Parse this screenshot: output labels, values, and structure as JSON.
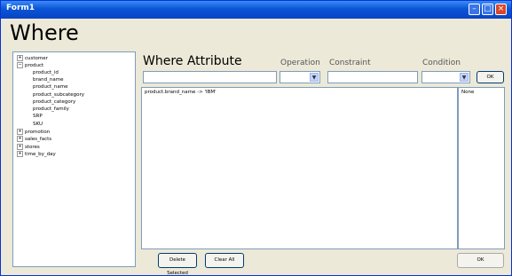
{
  "window": {
    "title": "Form1"
  },
  "heading": "Where",
  "tree": {
    "nodes": [
      {
        "label": "customer",
        "expander": "+"
      },
      {
        "label": "product",
        "expander": "−"
      },
      {
        "label": "product_id",
        "expander": ""
      },
      {
        "label": "brand_name",
        "expander": ""
      },
      {
        "label": "product_name",
        "expander": ""
      },
      {
        "label": "product_subcategory",
        "expander": ""
      },
      {
        "label": "product_category",
        "expander": ""
      },
      {
        "label": "product_family",
        "expander": ""
      },
      {
        "label": "SRP",
        "expander": ""
      },
      {
        "label": "SKU",
        "expander": ""
      },
      {
        "label": "promotion",
        "expander": "+"
      },
      {
        "label": "sales_facts",
        "expander": "+"
      },
      {
        "label": "stores",
        "expander": "+"
      },
      {
        "label": "time_by_day",
        "expander": "+"
      }
    ]
  },
  "where_attribute": {
    "title": "Where Attribute"
  },
  "labels": {
    "operation": "Operation",
    "constraint": "Constraint",
    "condition": "Condition"
  },
  "buttons": {
    "ok_small": "OK",
    "delete_selected": "Delete Selected",
    "clear_all": "Clear All",
    "ok_bottom": "OK"
  },
  "conditions_list": [
    "product.brand_name -> 'IBM'"
  ],
  "right_list": [
    "None"
  ],
  "icons": {
    "dropdown": "chevron-down-icon",
    "minimize": "minimize-icon",
    "maximize": "maximize-icon",
    "close": "close-icon"
  },
  "colors": {
    "titlebar": "#0a55d6",
    "window_bg": "#ece9d8",
    "close": "#d7472b"
  }
}
